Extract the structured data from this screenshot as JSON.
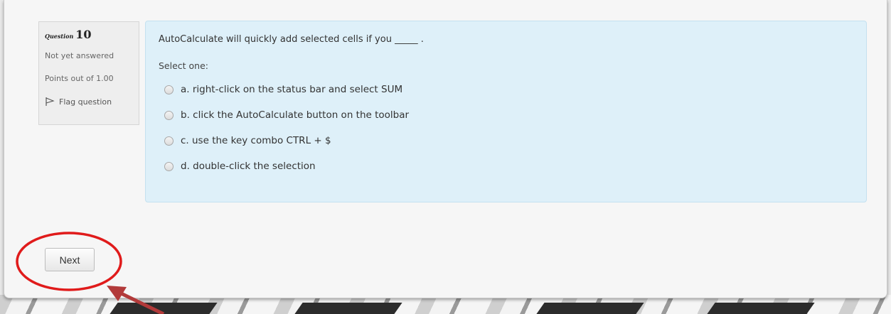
{
  "question": {
    "label_word": "Question",
    "number": "10",
    "status": "Not yet answered",
    "points": "Points out of 1.00",
    "flag_label": "Flag question",
    "text": "AutoCalculate will quickly add selected cells if you _____ .",
    "prompt": "Select one:",
    "options": [
      {
        "label": "a. right-click on the status bar and select SUM"
      },
      {
        "label": "b. click the AutoCalculate button on the toolbar"
      },
      {
        "label": "c. use the key combo CTRL + $"
      },
      {
        "label": "d. double-click the selection"
      }
    ]
  },
  "navigation": {
    "next_label": "Next"
  },
  "colors": {
    "content_bg": "#def0f9",
    "annotation_red": "#e01b1b",
    "arrow": "#b23a3a"
  },
  "icons": {
    "flag": "flag-icon"
  }
}
